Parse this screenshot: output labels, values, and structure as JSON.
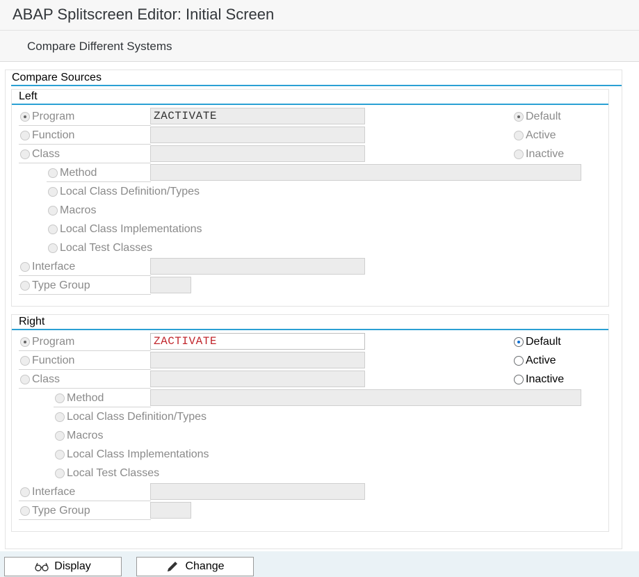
{
  "window": {
    "title": "ABAP Splitscreen Editor: Initial Screen"
  },
  "toolbar": {
    "compare_systems": "Compare Different Systems"
  },
  "compare_sources": {
    "title": "Compare Sources",
    "left": {
      "title": "Left",
      "program": {
        "label": "Program",
        "value": "ZACTIVATE"
      },
      "function": {
        "label": "Function",
        "value": ""
      },
      "class": {
        "label": "Class",
        "value": ""
      },
      "method": {
        "label": "Method",
        "value": ""
      },
      "local_class_def": {
        "label": "Local Class Definition/Types"
      },
      "macros": {
        "label": "Macros"
      },
      "local_class_impl": {
        "label": "Local Class Implementations"
      },
      "local_test": {
        "label": "Local Test Classes"
      },
      "interface": {
        "label": "Interface",
        "value": ""
      },
      "type_group": {
        "label": "Type Group",
        "value": ""
      },
      "version": {
        "default": "Default",
        "active": "Active",
        "inactive": "Inactive",
        "selected": "Default"
      }
    },
    "right": {
      "title": "Right",
      "program": {
        "label": "Program",
        "value": "ZACTIVATE"
      },
      "function": {
        "label": "Function",
        "value": ""
      },
      "class": {
        "label": "Class",
        "value": ""
      },
      "method": {
        "label": "Method",
        "value": ""
      },
      "local_class_def": {
        "label": "Local Class Definition/Types"
      },
      "macros": {
        "label": "Macros"
      },
      "local_class_impl": {
        "label": "Local Class Implementations"
      },
      "local_test": {
        "label": "Local Test Classes"
      },
      "interface": {
        "label": "Interface",
        "value": ""
      },
      "type_group": {
        "label": "Type Group",
        "value": ""
      },
      "version": {
        "default": "Default",
        "active": "Active",
        "inactive": "Inactive",
        "selected": "Default"
      }
    }
  },
  "buttons": {
    "display": {
      "label": "Display",
      "icon": "glasses-icon"
    },
    "change": {
      "label": "Change",
      "icon": "pencil-icon"
    }
  },
  "colors": {
    "accent": "#2aa0d4",
    "value_text": "#c1272d",
    "radio_selected": "#0a6ed1"
  }
}
